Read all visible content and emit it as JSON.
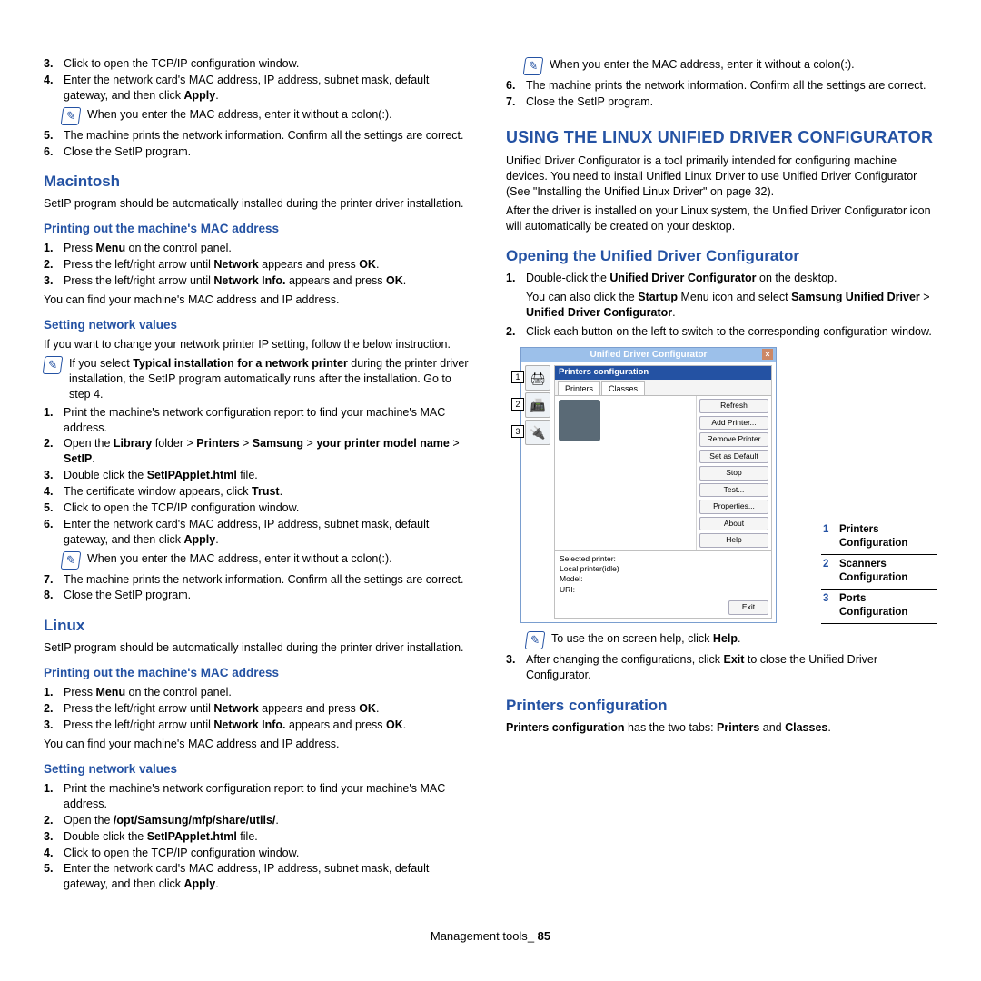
{
  "left": {
    "top_ol": [
      {
        "n": "3.",
        "t": "Click to open the TCP/IP configuration window."
      },
      {
        "n": "4.",
        "t": "Enter the network card's MAC address, IP address, subnet mask, default gateway, and then click <b>Apply</b>."
      }
    ],
    "top_note": "When you enter the MAC address, enter it without a colon(:).",
    "top_ol2": [
      {
        "n": "5.",
        "t": "The machine prints the network information. Confirm all the settings are correct."
      },
      {
        "n": "6.",
        "t": "Close the SetIP program."
      }
    ],
    "mac_h": "Macintosh",
    "mac_p": "SetIP program should be automatically installed during the printer driver installation.",
    "mac_print_h": "Printing out the machine's MAC address",
    "mac_print_ol": [
      {
        "n": "1.",
        "t": "Press <b>Menu</b> on the control panel."
      },
      {
        "n": "2.",
        "t": "Press the left/right arrow until <b>Network</b> appears and press <b>OK</b>."
      },
      {
        "n": "3.",
        "t": "Press the left/right arrow until <b>Network Info.</b> appears and press <b>OK</b>."
      }
    ],
    "mac_print_p": "You can find your machine's MAC address and IP address.",
    "mac_set_h": "Setting network values",
    "mac_set_p": "If you want to change your network printer IP setting, follow the below instruction.",
    "mac_set_note": "If you select <b>Typical installation for a network printer</b> during the printer driver installation, the SetIP program automatically runs after the installation. Go to step 4.",
    "mac_set_ol": [
      {
        "n": "1.",
        "t": "Print the machine's network configuration report to find your machine's MAC address."
      },
      {
        "n": "2.",
        "t": "Open the <b>Library</b> folder > <b>Printers</b> > <b>Samsung</b> > <b>your printer model name</b> > <b>SetIP</b>."
      },
      {
        "n": "3.",
        "t": "Double click the <b>SetIPApplet.html</b> file."
      },
      {
        "n": "4.",
        "t": "The certificate window appears, click <b>Trust</b>."
      },
      {
        "n": "5.",
        "t": "Click to open the TCP/IP configuration window."
      },
      {
        "n": "6.",
        "t": "Enter the network card's MAC address, IP address, subnet mask, default gateway, and then click <b>Apply</b>."
      }
    ],
    "mac_set_note2": "When you enter the MAC address, enter it without a colon(:).",
    "mac_set_ol2": [
      {
        "n": "7.",
        "t": "The machine prints the network information. Confirm all the settings are correct."
      },
      {
        "n": "8.",
        "t": "Close the SetIP program."
      }
    ],
    "lin_h": "Linux",
    "lin_p": "SetIP program should be automatically installed during the printer driver installation.",
    "lin_print_h": "Printing out the machine's MAC address",
    "lin_print_ol": [
      {
        "n": "1.",
        "t": "Press <b>Menu</b> on the control panel."
      },
      {
        "n": "2.",
        "t": "Press the left/right arrow until <b>Network</b> appears and press <b>OK</b>."
      },
      {
        "n": "3.",
        "t": "Press the left/right arrow until <b>Network Info.</b> appears and press <b>OK</b>."
      }
    ],
    "lin_print_p": "You can find your machine's MAC address and IP address.",
    "lin_set_h": "Setting network values",
    "lin_set_ol": [
      {
        "n": "1.",
        "t": "Print the machine's network configuration report to find your machine's MAC address."
      },
      {
        "n": "2.",
        "t": "Open the <b>/opt/Samsung/mfp/share/utils/</b>."
      },
      {
        "n": "3.",
        "t": "Double click the <b>SetIPApplet.html</b> file."
      },
      {
        "n": "4.",
        "t": "Click to open the TCP/IP configuration window."
      },
      {
        "n": "5.",
        "t": "Enter the network card's MAC address, IP address, subnet mask, default gateway, and then click <b>Apply</b>."
      }
    ]
  },
  "right": {
    "top_note": "When you enter the MAC address, enter it without a colon(:).",
    "top_ol": [
      {
        "n": "6.",
        "t": "The machine prints the network information. Confirm all the settings are correct."
      },
      {
        "n": "7.",
        "t": "Close the SetIP program."
      }
    ],
    "h1": "USING THE LINUX UNIFIED DRIVER CONFIGURATOR",
    "p1": "Unified Driver Configurator is a tool primarily intended for configuring machine devices. You need to install Unified Linux Driver to use Unified Driver Configurator (See \"Installing the Unified Linux Driver\" on page 32).",
    "p2": "After the driver is installed on your Linux system, the Unified Driver Configurator icon will automatically be created on your desktop.",
    "open_h": "Opening the Unified Driver Configurator",
    "open_ol1": [
      {
        "n": "1.",
        "t": "Double-click the <b>Unified Driver Configurator</b> on the desktop."
      }
    ],
    "open_sub": "You can also click the <b>Startup</b> Menu icon and select <b>Samsung Unified Driver</b> > <b>Unified Driver Configurator</b>.",
    "open_ol2": [
      {
        "n": "2.",
        "t": "Click each button on the left to switch to the corresponding configuration window."
      }
    ],
    "dialog": {
      "title": "Unified Driver Configurator",
      "section": "Printers configuration",
      "tabs": [
        "Printers",
        "Classes"
      ],
      "btns": [
        "Refresh",
        "Add Printer...",
        "Remove Printer",
        "Set as Default",
        "Stop",
        "Test...",
        "Properties...",
        "About",
        "Help"
      ],
      "sel_label": "Selected printer:",
      "sel_lines": [
        "Local printer(idle)",
        "Model:",
        "URI:"
      ],
      "exit": "Exit"
    },
    "legend": [
      {
        "n": "1",
        "t": "Printers Configuration"
      },
      {
        "n": "2",
        "t": "Scanners Configuration"
      },
      {
        "n": "3",
        "t": "Ports Configuration"
      }
    ],
    "post_note": "To use the on screen help, click <b>Help</b>.",
    "post_ol": [
      {
        "n": "3.",
        "t": "After changing the configurations, click <b>Exit</b> to close the Unified Driver Configurator."
      }
    ],
    "pc_h": "Printers configuration",
    "pc_p": "<b>Printers configuration</b> has the two tabs: <b>Printers</b> and <b>Classes</b>."
  },
  "footer": {
    "a": "Management tools",
    "b": "_ ",
    "c": "85"
  }
}
